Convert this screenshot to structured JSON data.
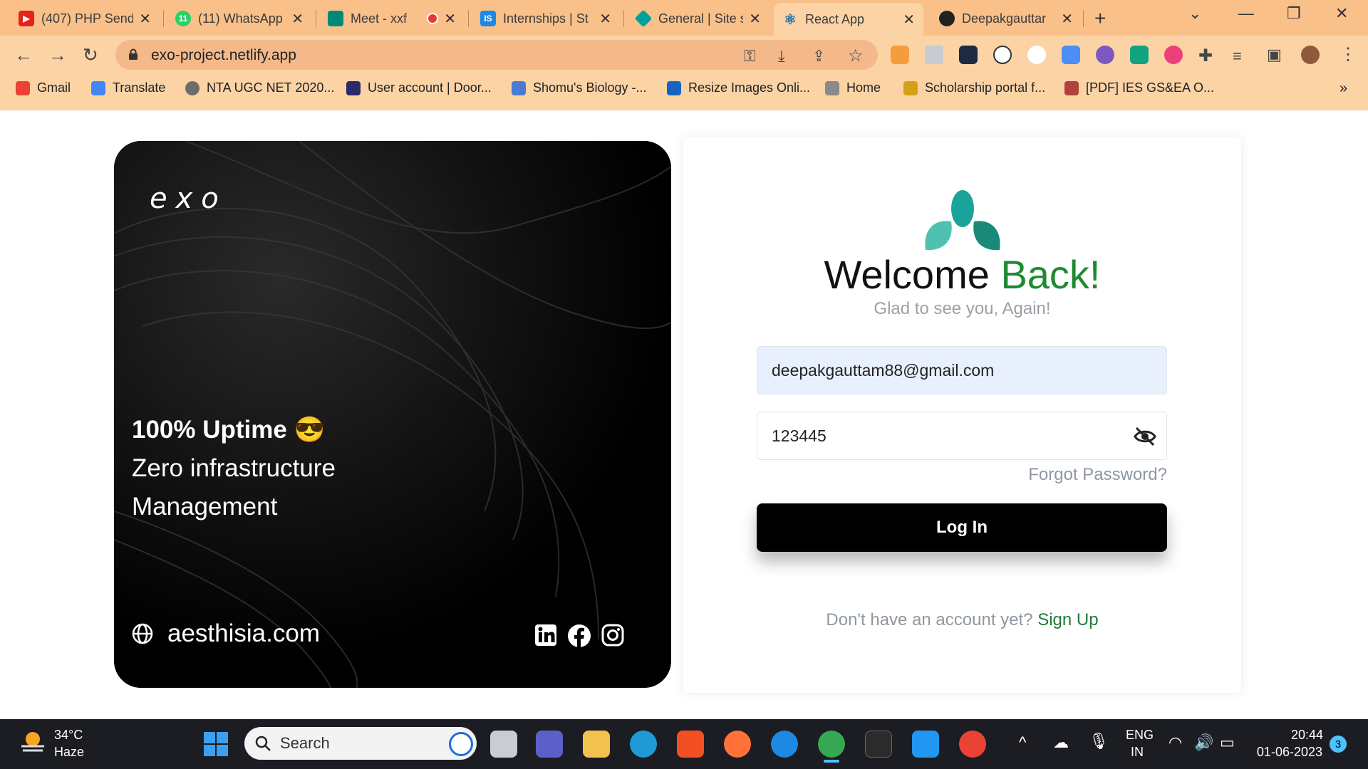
{
  "browser": {
    "tabs": [
      {
        "title": "(407) PHP Send",
        "color": "#e62117"
      },
      {
        "title": "(11) WhatsApp",
        "color": "#25d366"
      },
      {
        "title": "Meet - xxf",
        "color": "#00897b"
      },
      {
        "title": "Internships | St",
        "color": "#1e88e5"
      },
      {
        "title": "General | Site s",
        "color": "#00a0a0"
      },
      {
        "title": "React App",
        "color": "#61dafb"
      },
      {
        "title": "Deepakgauttar",
        "color": "#222222"
      }
    ],
    "active_tab": "React App",
    "url": "exo-project.netlify.app",
    "bookmarks": [
      "Gmail",
      "Translate",
      "NTA UGC NET 2020...",
      "User account | Door...",
      "Shomu's Biology -...",
      "Resize Images Onli...",
      "Home",
      "Scholarship portal f...",
      "[PDF] IES GS&EA O..."
    ],
    "bookmarks_overflow": "»"
  },
  "hero": {
    "logo": "exo",
    "line1": "100% Uptime 😎",
    "line2": "Zero infrastructure",
    "line3": "Management",
    "site": "aesthisia.com",
    "socials": [
      "linkedin-icon",
      "facebook-icon",
      "instagram-icon"
    ]
  },
  "login": {
    "title_plain": "Welcome ",
    "title_accent": "Back!",
    "subtitle": "Glad to see you, Again!",
    "email_value": "deepakgauttam88@gmail.com",
    "password_value": "123445",
    "forgot": "Forgot Password?",
    "login_button": "Log In",
    "signup_prompt": "Don't have an account yet?",
    "signup_link": "Sign Up",
    "accent_color": "#1f8a2f"
  },
  "taskbar": {
    "weather_temp": "34°C",
    "weather_desc": "Haze",
    "search_placeholder": "Search",
    "lang": "ENG",
    "region": "IN",
    "time": "20:44",
    "date": "01-06-2023",
    "notifications": "3"
  }
}
